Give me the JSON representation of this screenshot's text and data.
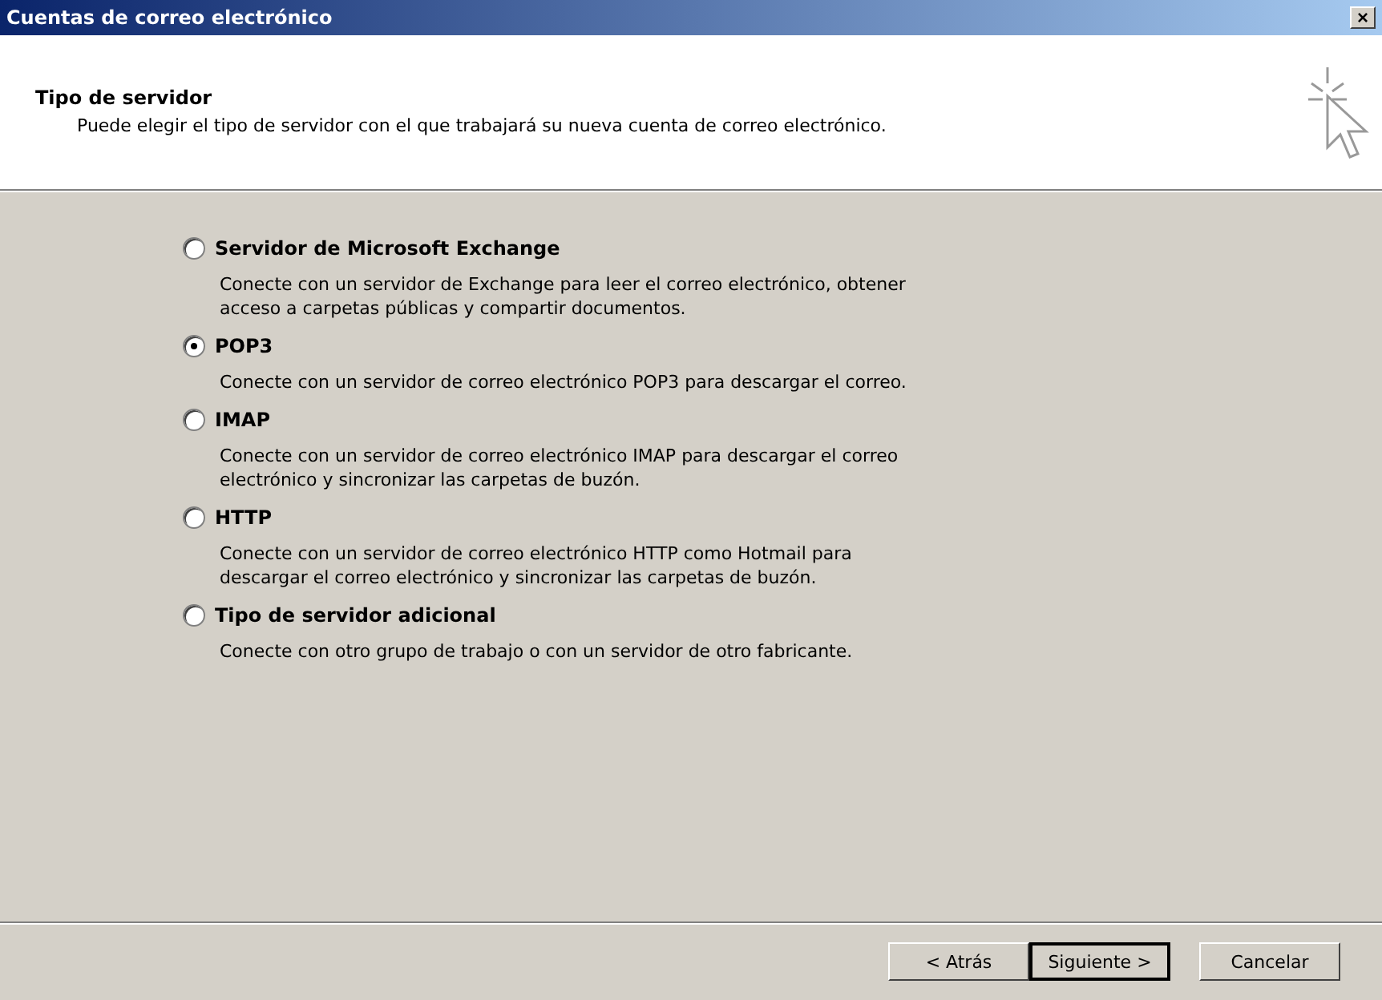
{
  "window": {
    "title": "Cuentas de correo electrónico",
    "close": "×"
  },
  "header": {
    "title": "Tipo de servidor",
    "subtitle": "Puede elegir el tipo de servidor con el que trabajará su nueva cuenta de correo electrónico."
  },
  "options": [
    {
      "label": "Servidor de Microsoft Exchange",
      "description": "Conecte con un servidor de Exchange para leer el correo electrónico, obtener\nacceso a carpetas públicas y compartir documentos.",
      "selected": false
    },
    {
      "label": "POP3",
      "description": "Conecte con un servidor de correo electrónico POP3 para descargar el correo.",
      "selected": true
    },
    {
      "label": "IMAP",
      "description": "Conecte con un servidor de correo electrónico IMAP para descargar el correo\nelectrónico y sincronizar las carpetas de buzón.",
      "selected": false
    },
    {
      "label": "HTTP",
      "description": "Conecte con un servidor de correo electrónico HTTP como Hotmail para\ndescargar el correo electrónico y sincronizar las carpetas de buzón.",
      "selected": false
    },
    {
      "label": "Tipo de servidor adicional",
      "description": "Conecte con otro grupo de trabajo o con un servidor de otro fabricante.",
      "selected": false
    }
  ],
  "buttons": [
    {
      "label": "< Atrás",
      "default": false
    },
    {
      "label": "Siguiente >",
      "default": true
    },
    {
      "label": "Cancelar",
      "default": false
    }
  ]
}
